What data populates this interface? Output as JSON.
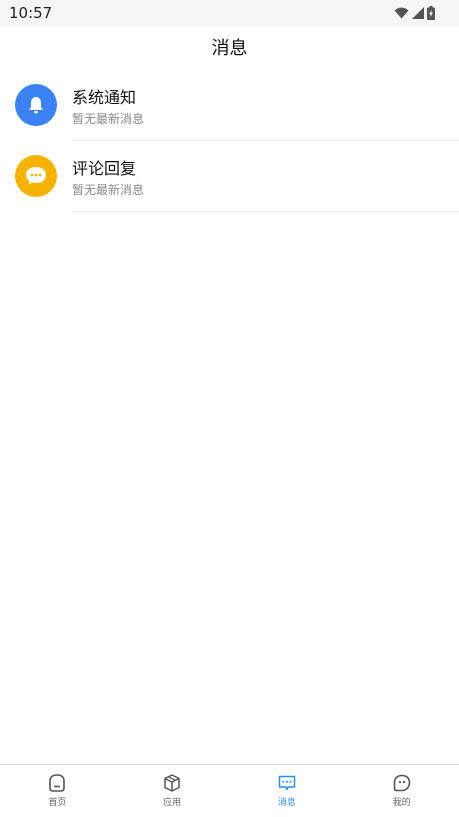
{
  "status_bar": {
    "time": "10:57"
  },
  "header": {
    "title": "消息"
  },
  "messages": [
    {
      "title": "系统通知",
      "subtitle": "暂无最新消息",
      "icon": "bell-icon",
      "color": "#3b82f6"
    },
    {
      "title": "评论回复",
      "subtitle": "暂无最新消息",
      "icon": "chat-bubble-icon",
      "color": "#f5b300"
    }
  ],
  "tab_bar": {
    "active_color": "#2d8cf0",
    "tabs": [
      {
        "label": "首页",
        "icon": "home-icon"
      },
      {
        "label": "应用",
        "icon": "cube-icon"
      },
      {
        "label": "消息",
        "icon": "message-icon",
        "active": true
      },
      {
        "label": "我的",
        "icon": "profile-icon"
      }
    ]
  }
}
